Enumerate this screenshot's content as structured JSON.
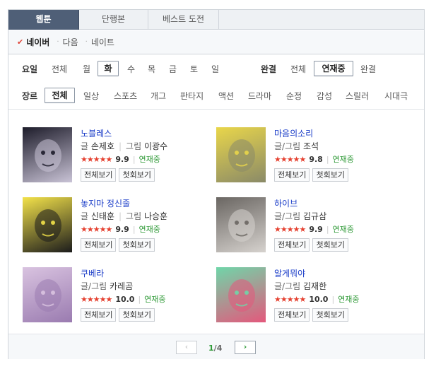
{
  "tabs": [
    {
      "label": "웹툰",
      "active": true
    },
    {
      "label": "단행본",
      "active": false
    },
    {
      "label": "베스트 도전",
      "active": false
    }
  ],
  "portals": [
    {
      "label": "네이버",
      "active": true
    },
    {
      "label": "다음",
      "active": false
    },
    {
      "label": "네이트",
      "active": false
    }
  ],
  "day_filter": {
    "label": "요일",
    "items": [
      "전체",
      "월",
      "화",
      "수",
      "목",
      "금",
      "토",
      "일"
    ],
    "selected": "화"
  },
  "completion_filter": {
    "label": "완결",
    "items": [
      "전체",
      "연재중",
      "완결"
    ],
    "selected": "연재중"
  },
  "genre_filter": {
    "label": "장르",
    "items": [
      "전체",
      "일상",
      "스포츠",
      "개그",
      "판타지",
      "액션",
      "드라마",
      "순정",
      "감성",
      "스릴러",
      "시대극"
    ],
    "selected": "전체"
  },
  "comics": [
    {
      "title": "노블레스",
      "writer_label": "글",
      "writer": "손제호",
      "artist_label": "그림",
      "artist": "이광수",
      "score": "9.9",
      "status": "연재중",
      "stars": 5,
      "thumb_icon": "noblesse-thumbnail",
      "thumb_colors": [
        "#1d1c2a",
        "#c9c3d6"
      ]
    },
    {
      "title": "마음의소리",
      "writer_label": "글/그림",
      "writer": "조석",
      "artist_label": "",
      "artist": "",
      "score": "9.8",
      "status": "연재중",
      "stars": 5,
      "thumb_icon": "maeum-thumbnail",
      "thumb_colors": [
        "#e9d64a",
        "#8a8a68"
      ]
    },
    {
      "title": "놓지마 정신줄",
      "writer_label": "글",
      "writer": "신태훈",
      "artist_label": "그림",
      "artist": "나승훈",
      "score": "9.9",
      "status": "연재중",
      "stars": 5,
      "thumb_icon": "jungsinjul-thumbnail",
      "thumb_colors": [
        "#f3e24a",
        "#1c1c1c"
      ]
    },
    {
      "title": "하이브",
      "writer_label": "글/그림",
      "writer": "김규삼",
      "artist_label": "",
      "artist": "",
      "score": "9.9",
      "status": "연재중",
      "stars": 5,
      "thumb_icon": "hive-thumbnail",
      "thumb_colors": [
        "#6a6662",
        "#d6d2ce"
      ]
    },
    {
      "title": "쿠베라",
      "writer_label": "글/그림",
      "writer": "카레곰",
      "artist_label": "",
      "artist": "",
      "score": "10.0",
      "status": "연재중",
      "stars": 5,
      "thumb_icon": "kubera-thumbnail",
      "thumb_colors": [
        "#d9c3e0",
        "#9a7bb0"
      ]
    },
    {
      "title": "알게뭐야",
      "writer_label": "글/그림",
      "writer": "김재한",
      "artist_label": "",
      "artist": "",
      "score": "10.0",
      "status": "연재중",
      "stars": 5,
      "thumb_icon": "algemwoya-thumbnail",
      "thumb_colors": [
        "#6fd6a9",
        "#e4587c"
      ]
    }
  ],
  "buttons": {
    "view_all": "전체보기",
    "first_view": "첫회보기"
  },
  "pagination": {
    "current": "1",
    "separator": "/",
    "total": "4",
    "prev_icon": "chevron-left-icon",
    "next_icon": "chevron-right-icon"
  },
  "colors": {
    "active_tab": "#4f5f77",
    "title_link": "#1a3cc8",
    "status_green": "#2f9a37",
    "stars_red": "#e5402f",
    "check_red": "#e0483c"
  }
}
